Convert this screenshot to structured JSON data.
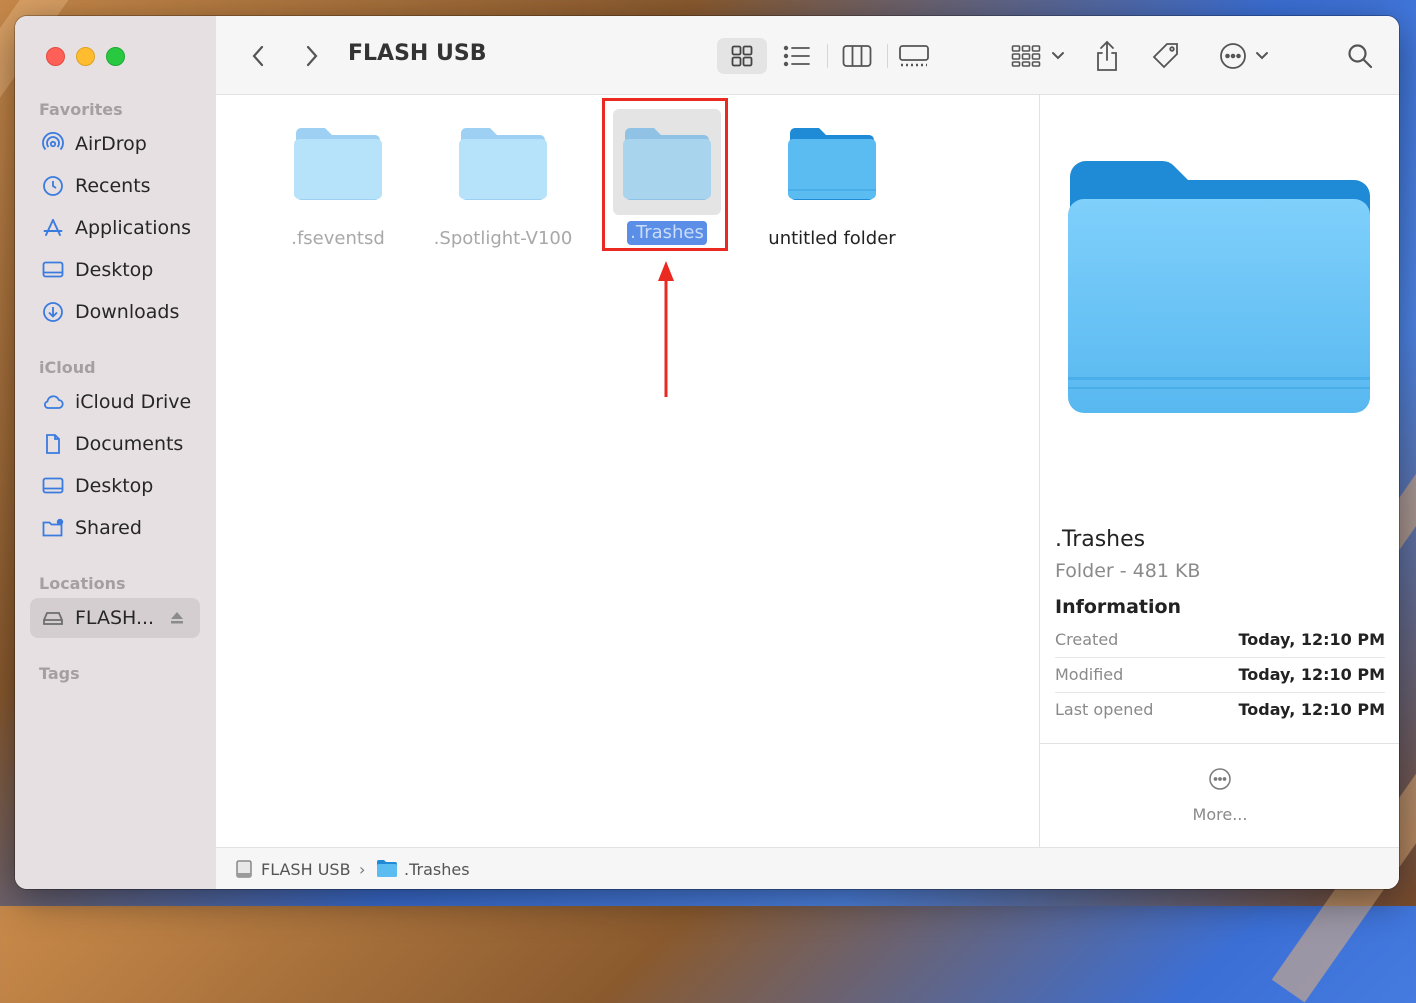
{
  "window": {
    "title": "FLASH USB"
  },
  "sidebar": {
    "sections": {
      "favorites": "Favorites",
      "icloud": "iCloud",
      "locations": "Locations",
      "tags": "Tags"
    },
    "favorites": [
      {
        "label": "AirDrop",
        "icon": "airdrop-icon"
      },
      {
        "label": "Recents",
        "icon": "clock-icon"
      },
      {
        "label": "Applications",
        "icon": "applications-icon"
      },
      {
        "label": "Desktop",
        "icon": "desktop-icon"
      },
      {
        "label": "Downloads",
        "icon": "download-icon"
      }
    ],
    "icloud": [
      {
        "label": "iCloud Drive",
        "icon": "cloud-icon"
      },
      {
        "label": "Documents",
        "icon": "document-icon"
      },
      {
        "label": "Desktop",
        "icon": "desktop-icon"
      },
      {
        "label": "Shared",
        "icon": "shared-folder-icon"
      }
    ],
    "locations": [
      {
        "label": "FLASH...",
        "icon": "drive-icon",
        "selected": true
      }
    ]
  },
  "files": [
    {
      "name": ".fseventsd",
      "hidden": true
    },
    {
      "name": ".Spotlight-V100",
      "hidden": true
    },
    {
      "name": ".Trashes",
      "hidden": true,
      "selected": true
    },
    {
      "name": "untitled folder",
      "hidden": false
    }
  ],
  "preview": {
    "name": ".Trashes",
    "kind_size": "Folder - 481 KB",
    "info_heading": "Information",
    "rows": [
      {
        "key": "Created",
        "value": "Today, 12:10 PM"
      },
      {
        "key": "Modified",
        "value": "Today, 12:10 PM"
      },
      {
        "key": "Last opened",
        "value": "Today, 12:10 PM"
      }
    ],
    "more_label": "More..."
  },
  "pathbar": {
    "root": "FLASH USB",
    "separator": "›",
    "current": ".Trashes"
  },
  "colors": {
    "accent": "#5b8ee7",
    "highlight": "#ea2a20",
    "folder": "#5bbcf2",
    "sidebar_icon": "#3a7be0"
  }
}
